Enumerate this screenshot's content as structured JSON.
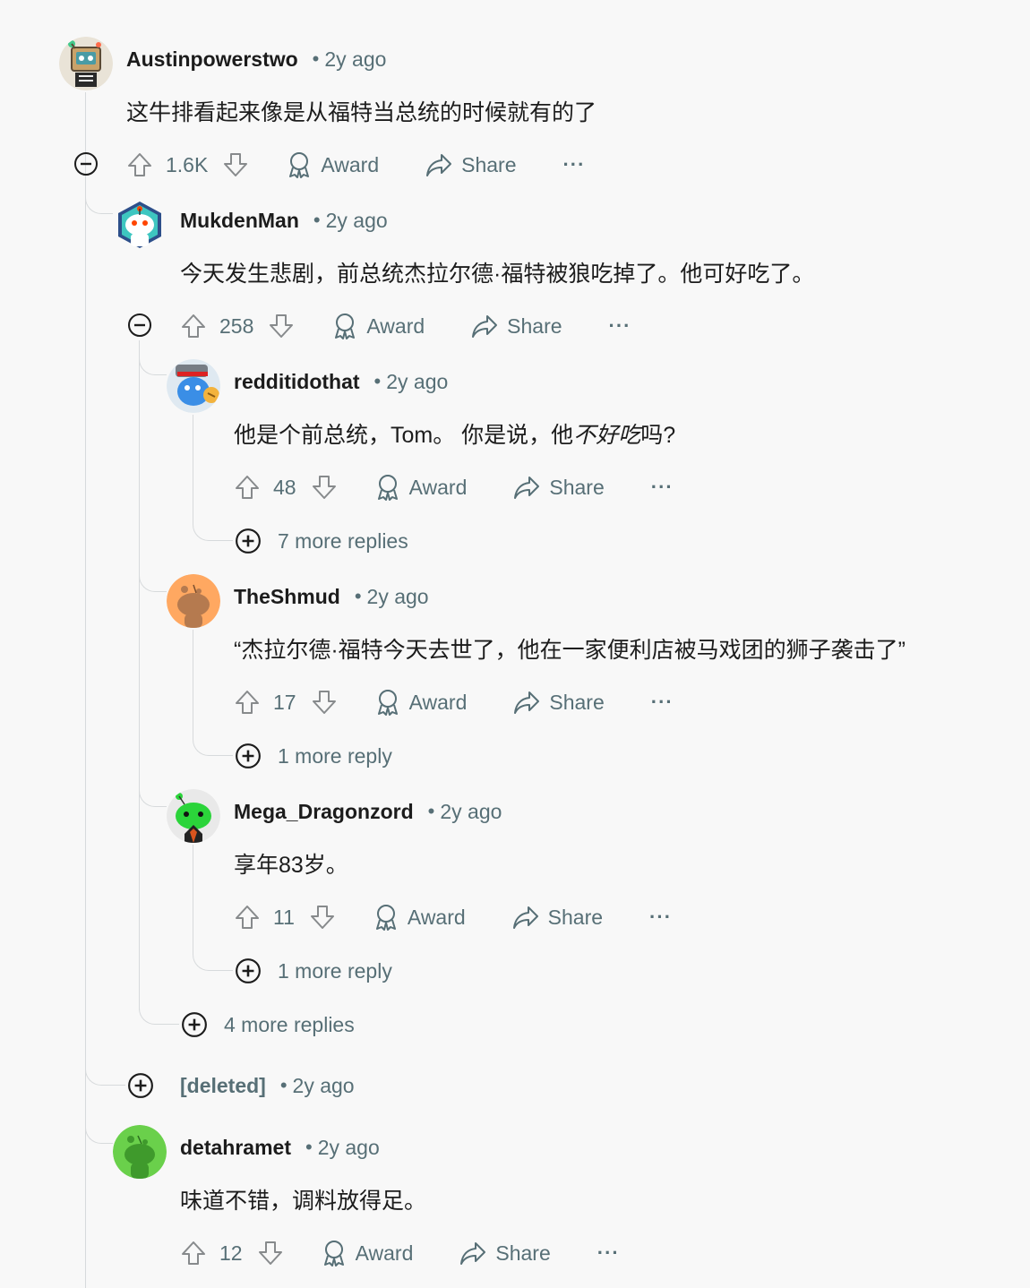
{
  "comments": [
    {
      "user": "Austinpowerstwo",
      "time": "2y ago",
      "body": "这牛排看起来像是从福特当总统的时候就有的了",
      "score": "1.6K"
    },
    {
      "user": "MukdenMan",
      "time": "2y ago",
      "body": "今天发生悲剧，前总统杰拉尔德·福特被狼吃掉了。他可好吃了。",
      "score": "258"
    },
    {
      "user": "redditidothat",
      "time": "2y ago",
      "body_before": "他是个前总统，Tom。 你是说，他",
      "body_italic": "不好吃",
      "body_after": "吗?",
      "score": "48",
      "more": "7 more replies"
    },
    {
      "user": "TheShmud",
      "time": "2y ago",
      "body": "“杰拉尔德·福特今天去世了，他在一家便利店被马戏团的狮子袭击了”",
      "score": "17",
      "more": "1 more reply"
    },
    {
      "user": "Mega_Dragonzord",
      "time": "2y ago",
      "body": "享年83岁。",
      "score": "11",
      "more": "1 more reply"
    },
    {
      "user": "[deleted]",
      "time": "2y ago"
    },
    {
      "user": "detahramet",
      "time": "2y ago",
      "body": "味道不错，调料放得足。",
      "score": "12"
    }
  ],
  "thread_more": "4 more replies",
  "labels": {
    "award": "Award",
    "share": "Share",
    "overflow": "···",
    "dot": "•"
  },
  "icons": [
    "upvote-icon",
    "downvote-icon",
    "award-icon",
    "share-icon",
    "collapse-icon",
    "expand-icon"
  ],
  "colors": {
    "background": "#f8f8f8",
    "meta": "#576f76",
    "text": "#1c1c1c",
    "thread_line": "#d7dadc"
  }
}
